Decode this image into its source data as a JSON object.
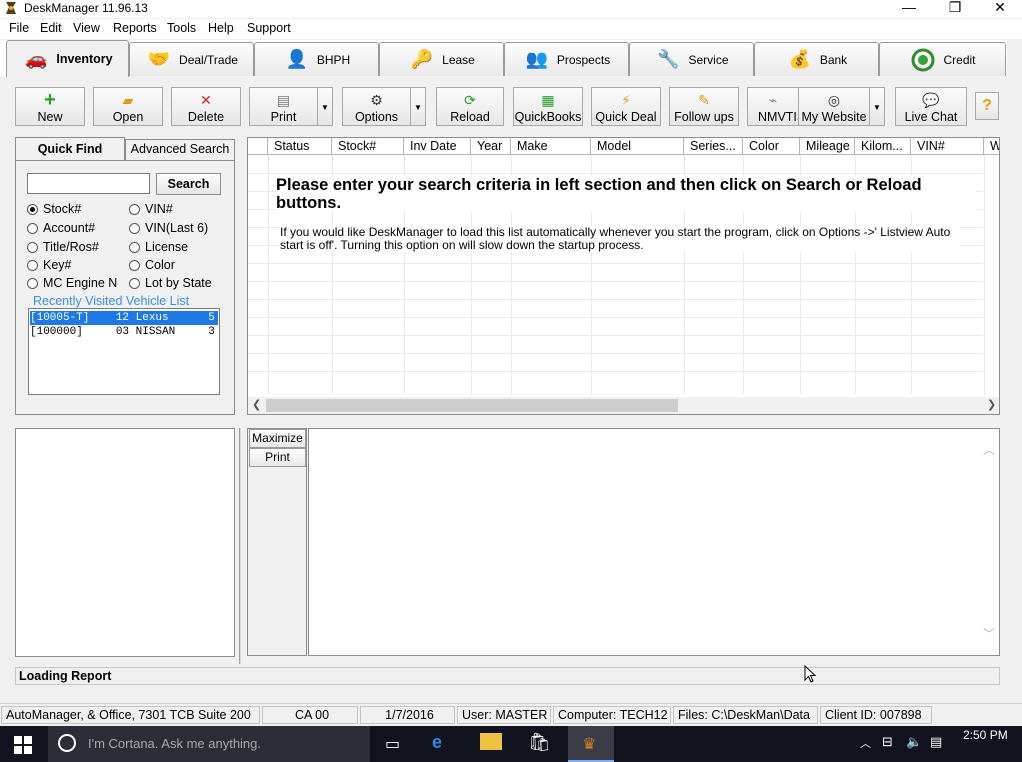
{
  "window": {
    "title": "DeskManager 11.96.13",
    "min": "—",
    "restore": "❐",
    "close": "✕"
  },
  "menu": [
    "File",
    "Edit",
    "View",
    "Reports",
    "Tools",
    "Help",
    "Support"
  ],
  "tabs": [
    {
      "label": "Inventory",
      "icon": "car-icon",
      "glyph": "🚗",
      "active": true
    },
    {
      "label": "Deal/Trade",
      "icon": "handshake-icon",
      "glyph": "🤝"
    },
    {
      "label": "BHPH",
      "icon": "person-dollar-icon",
      "glyph": "👤"
    },
    {
      "label": "Lease",
      "icon": "keys-icon",
      "glyph": "🔑"
    },
    {
      "label": "Prospects",
      "icon": "people-icon",
      "glyph": "👥"
    },
    {
      "label": "Service",
      "icon": "tools-icon",
      "glyph": "🔧"
    },
    {
      "label": "Bank",
      "icon": "money-bag-icon",
      "glyph": "💰"
    },
    {
      "label": "Credit",
      "icon": "credit-gauge-icon",
      "glyph": "◎"
    }
  ],
  "toolbar": {
    "new": "New",
    "open": "Open",
    "delete": "Delete",
    "print": "Print",
    "options": "Options",
    "reload": "Reload",
    "quickbooks": "QuickBooks",
    "quick_deal": "Quick Deal",
    "follow_ups": "Follow ups",
    "nmvtis": "NMVTIS",
    "my_website": "My Website",
    "live_chat": "Live Chat",
    "help": "?"
  },
  "quickfind": {
    "tab_quick": "Quick Find",
    "tab_advanced": "Advanced Search",
    "search_value": "",
    "search_button": "Search",
    "options": [
      {
        "label": "Stock#",
        "checked": true
      },
      {
        "label": "VIN#",
        "checked": false
      },
      {
        "label": "Account#",
        "checked": false
      },
      {
        "label": "VIN(Last 6)",
        "checked": false
      },
      {
        "label": "Title/Ros#",
        "checked": false
      },
      {
        "label": "License",
        "checked": false
      },
      {
        "label": "Key#",
        "checked": false
      },
      {
        "label": "Color",
        "checked": false
      },
      {
        "label": "MC Engine N",
        "checked": false
      },
      {
        "label": "Lot by State",
        "checked": false
      }
    ],
    "recent_label": "Recently Visited Vehicle List",
    "recent": [
      {
        "text": "[10005-T]    12 Lexus      5",
        "selected": true
      },
      {
        "text": "[100000]     03 NISSAN     3",
        "selected": false
      }
    ]
  },
  "grid": {
    "columns": [
      "Status",
      "Stock#",
      "Inv Date",
      "Year",
      "Make",
      "Model",
      "Series...",
      "Color",
      "Mileage",
      "Kilom...",
      "VIN#",
      "W"
    ],
    "message_title": "Please enter your search criteria in left section and then click on Search or Reload buttons.",
    "message_body": "If you would like DeskManager to load this list automatically whenever you start the program, click on Options ->' Listview Auto start is off'. Turning this option on will slow down the startup process."
  },
  "report": {
    "maximize": "Maximize",
    "print": "Print"
  },
  "loading": "Loading Report",
  "status": {
    "company": "AutoManager, & Office, 7301 TCB Suite 200",
    "state": "CA 00",
    "date": "1/7/2016",
    "user": "User: MASTER",
    "computer": "Computer: TECH12",
    "files": "Files: C:\\DeskMan\\Data",
    "client": "Client ID: 007898"
  },
  "taskbar": {
    "search_placeholder": "I'm Cortana. Ask me anything.",
    "time": "2:50 PM"
  }
}
